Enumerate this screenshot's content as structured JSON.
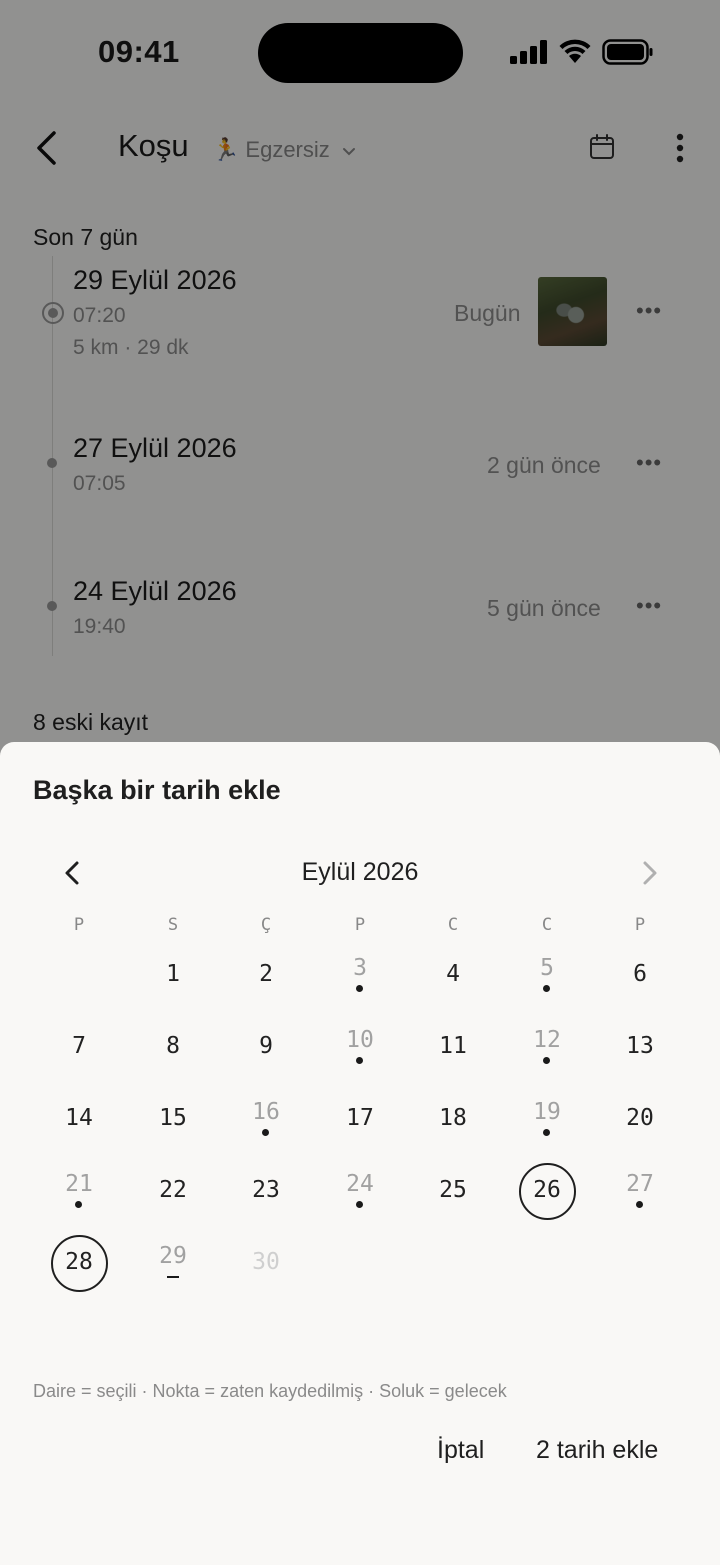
{
  "status_bar": {
    "time": "09:41"
  },
  "header": {
    "title": "Koşu",
    "category": "Egzersiz"
  },
  "recent": {
    "heading": "Son 7 gün",
    "entries": [
      {
        "date": "29 Eylül 2026",
        "time": "07:20",
        "stats": "5 km · 29 dk",
        "relative": "Bugün"
      },
      {
        "date": "27 Eylül 2026",
        "time": "07:05",
        "relative": "2 gün önce"
      },
      {
        "date": "24 Eylül 2026",
        "time": "19:40",
        "relative": "5 gün önce"
      }
    ]
  },
  "older": {
    "label": "8 eski kayıt"
  },
  "sheet": {
    "title": "Başka bir tarih ekle",
    "month": "Eylül 2026",
    "weekdays": [
      "P",
      "S",
      "Ç",
      "P",
      "C",
      "C",
      "P"
    ],
    "days": [
      {
        "n": "1",
        "state": "normal"
      },
      {
        "n": "2",
        "state": "normal"
      },
      {
        "n": "3",
        "state": "logged"
      },
      {
        "n": "4",
        "state": "normal"
      },
      {
        "n": "5",
        "state": "logged"
      },
      {
        "n": "6",
        "state": "normal"
      },
      {
        "n": "7",
        "state": "normal"
      },
      {
        "n": "8",
        "state": "normal"
      },
      {
        "n": "9",
        "state": "normal"
      },
      {
        "n": "10",
        "state": "logged"
      },
      {
        "n": "11",
        "state": "normal"
      },
      {
        "n": "12",
        "state": "logged"
      },
      {
        "n": "13",
        "state": "normal"
      },
      {
        "n": "14",
        "state": "normal"
      },
      {
        "n": "15",
        "state": "normal"
      },
      {
        "n": "16",
        "state": "logged"
      },
      {
        "n": "17",
        "state": "normal"
      },
      {
        "n": "18",
        "state": "normal"
      },
      {
        "n": "19",
        "state": "logged"
      },
      {
        "n": "20",
        "state": "normal"
      },
      {
        "n": "21",
        "state": "logged"
      },
      {
        "n": "22",
        "state": "normal"
      },
      {
        "n": "23",
        "state": "normal"
      },
      {
        "n": "24",
        "state": "logged"
      },
      {
        "n": "25",
        "state": "normal"
      },
      {
        "n": "26",
        "state": "selected"
      },
      {
        "n": "27",
        "state": "logged"
      },
      {
        "n": "28",
        "state": "selected"
      },
      {
        "n": "29",
        "state": "today"
      },
      {
        "n": "30",
        "state": "future"
      }
    ],
    "legend": "Daire = seçili · Nokta = zaten kaydedilmiş · Soluk = gelecek",
    "cancel": "İptal",
    "confirm": "2 tarih ekle"
  }
}
